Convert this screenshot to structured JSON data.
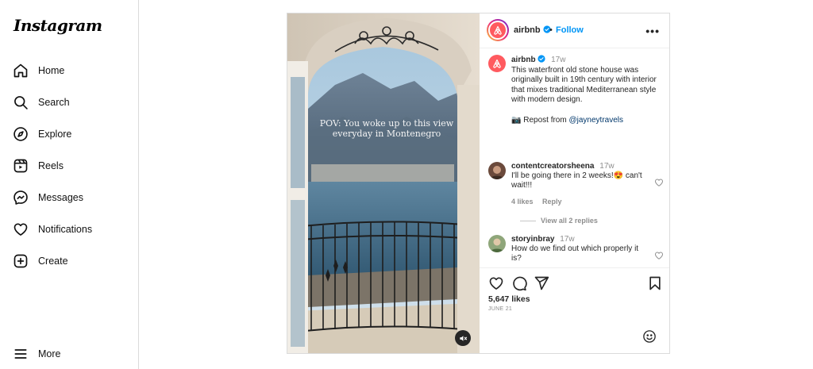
{
  "app": {
    "logo_text": "Instagram"
  },
  "sidebar": {
    "items": [
      {
        "label": "Home",
        "icon": "home-icon"
      },
      {
        "label": "Search",
        "icon": "search-icon"
      },
      {
        "label": "Explore",
        "icon": "compass-icon"
      },
      {
        "label": "Reels",
        "icon": "reels-icon"
      },
      {
        "label": "Messages",
        "icon": "messenger-icon"
      },
      {
        "label": "Notifications",
        "icon": "heart-icon"
      },
      {
        "label": "Create",
        "icon": "plus-square-icon"
      }
    ],
    "more_label": "More"
  },
  "post": {
    "overlay_text": "POV: You woke up to this view everyday in Montenegro",
    "header": {
      "username": "airbnb",
      "separator": "•",
      "follow_label": "Follow",
      "more_label": "•••"
    },
    "caption": {
      "username": "airbnb",
      "time": "17w",
      "text": "This waterfront old stone house was originally built in 19th century with interior that mixes traditional Mediterranean style with modern design.",
      "repost_prefix": "📷 Repost from",
      "repost_handle": "@jayneytravels"
    },
    "comments": [
      {
        "username": "contentcreatorsheena",
        "time": "17w",
        "text": "I'll be going there in 2 weeks!😍 can't wait!!!",
        "likes": "4 likes",
        "reply_label": "Reply",
        "view_replies": "View all 2 replies"
      },
      {
        "username": "storyinbray",
        "time": "17w",
        "text": "How do we find out which properly it is?"
      }
    ],
    "likes": "5,647 likes",
    "date": "JUNE 21"
  },
  "colors": {
    "brand_blue": "#0095f6",
    "airbnb_red": "#ff5a5f",
    "border": "#dbdbdb",
    "muted_text": "#8e8e8e"
  }
}
